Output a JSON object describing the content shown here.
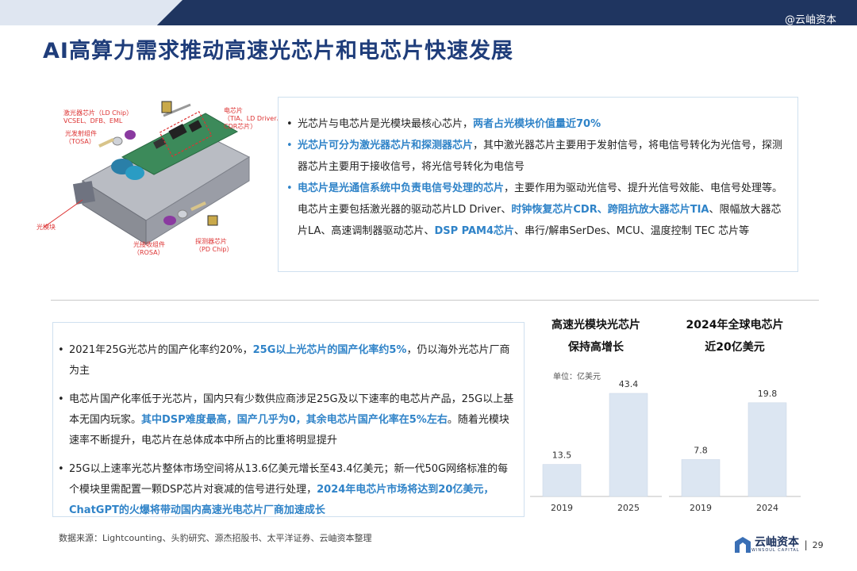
{
  "header": {
    "watermark": "@云岫资本"
  },
  "title": "AI高算力需求推动高速光芯片和电芯片快速发展",
  "diagram": {
    "labels": {
      "laser_chip": "激光器芯片（LD Chip）\nVCSEL、DFB、EML",
      "tosa": "光发射组件\n（TOSA）",
      "electrical_chip": "电芯片\n（TIA、LD Driver、\nCDR芯片）",
      "module": "光模块",
      "rosa": "光接收组件\n（ROSA）",
      "pd_chip": "探测器芯片\n（PD Chip）"
    }
  },
  "top_box": {
    "b1_text": "光芯片与电芯片是光模块最核心芯片，",
    "b1_hl": "两者占光模块价值量近70%",
    "b2_hl": "光芯片可分为激光器芯片和探测器芯片",
    "b2_text": "，其中激光器芯片主要用于发射信号，将电信号转化为光信号，探测器芯片主要用于接收信号，将光信号转化为电信号",
    "b3_hl1": "电芯片是光通信系统中负责电信号处理的芯片",
    "b3_t1": "，主要作用为驱动光信号、提升光信号效能、电信号处理等。电芯片主要包括激光器的驱动芯片LD Driver、",
    "b3_hl2": "时钟恢复芯片CDR、跨阻抗放大器芯片TIA",
    "b3_t2": "、限幅放大器芯片LA、高速调制器驱动芯片、",
    "b3_hl3": "DSP PAM4芯片",
    "b3_t3": "、串行/解串SerDes、MCU、温度控制 TEC 芯片等"
  },
  "bottom_box": {
    "b1_text": "2021年25G光芯片的国产化率约20%，",
    "b1_hl": "25G以上光芯片的国产化率约5%",
    "b1_text2": "，仍以海外光芯片厂商为主",
    "b2_text": "电芯片国产化率低于光芯片，国内只有少数供应商涉足25G及以下速率的电芯片产品，25G以上基本无国内玩家。",
    "b2_hl": "其中DSP难度最高，国产几乎为0，其余电芯片国产化率在5%左右",
    "b2_text2": "。随着光模块速率不断提升，电芯片在总体成本中所占的比重将明显提升",
    "b3_text": "25G以上速率光芯片整体市场空间将从13.6亿美元增长至43.4亿美元；新一代50G网络标准的每个模块里需配置一颗DSP芯片对衰减的信号进行处理，",
    "b3_hl": "2024年电芯片市场将达到20亿美元，ChatGPT的火爆将带动国内高速光电芯片厂商加速成长"
  },
  "chart_data": [
    {
      "type": "bar",
      "title": "高速光模块光芯片保持高增长",
      "title_line1": "高速光模块光芯片",
      "title_line2": "保持高增长",
      "unit": "单位：亿美元",
      "categories": [
        "2019",
        "2025"
      ],
      "values": [
        13.5,
        43.4
      ],
      "value_labels": [
        "13.5",
        "43.4"
      ],
      "color": "#dce6f2"
    },
    {
      "type": "bar",
      "title": "2024年全球电芯片近20亿美元",
      "title_line1": "2024年全球电芯片",
      "title_line2": "近20亿美元",
      "categories": [
        "2019",
        "2024"
      ],
      "values": [
        7.8,
        19.8
      ],
      "value_labels": [
        "7.8",
        "19.8"
      ],
      "color": "#dce6f2"
    }
  ],
  "footer": {
    "source": "数据来源：Lightcounting、头豹研究、源杰招股书、太平洋证券、云岫资本整理",
    "logo_name": "云岫资本",
    "logo_sub": "WINSOUL CAPITAL",
    "sep": "|",
    "page": "29"
  }
}
